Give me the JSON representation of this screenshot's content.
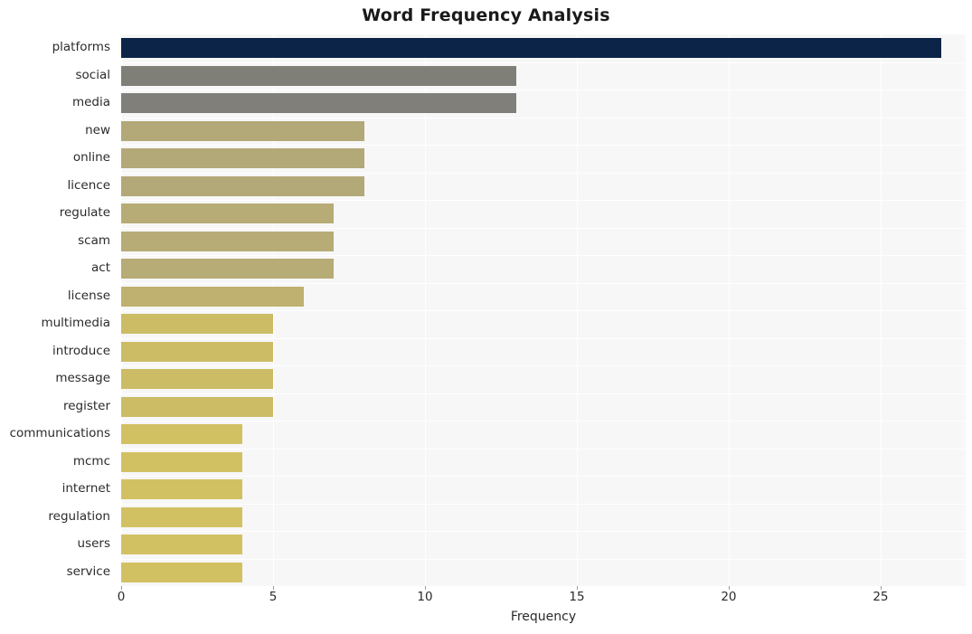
{
  "chart_data": {
    "type": "bar",
    "orientation": "horizontal",
    "title": "Word Frequency Analysis",
    "xlabel": "Frequency",
    "ylabel": "",
    "xlim": [
      0,
      27.8
    ],
    "xticks": [
      0,
      5,
      10,
      15,
      20,
      25
    ],
    "grid": "vertical",
    "legend": "none",
    "categories": [
      "platforms",
      "social",
      "media",
      "new",
      "online",
      "licence",
      "regulate",
      "scam",
      "act",
      "license",
      "multimedia",
      "introduce",
      "message",
      "register",
      "communications",
      "mcmc",
      "internet",
      "regulation",
      "users",
      "service"
    ],
    "values": [
      27,
      13,
      13,
      8,
      8,
      8,
      7,
      7,
      7,
      6,
      5,
      5,
      5,
      5,
      4,
      4,
      4,
      4,
      4,
      4
    ],
    "bar_colors": [
      "#0b2447",
      "#7f7f78",
      "#817f79",
      "#b3a878",
      "#b3a878",
      "#b3a878",
      "#b7ab76",
      "#b7ab76",
      "#b7ab76",
      "#bfb170",
      "#ccbc66",
      "#ccbc66",
      "#ccbc66",
      "#ccbc66",
      "#d2c163",
      "#d2c163",
      "#d2c163",
      "#d2c163",
      "#d2c163",
      "#d2c163"
    ],
    "plot_background": "#f7f7f7",
    "page_background": "#ffffff",
    "gridline_color": "#ffffff"
  }
}
